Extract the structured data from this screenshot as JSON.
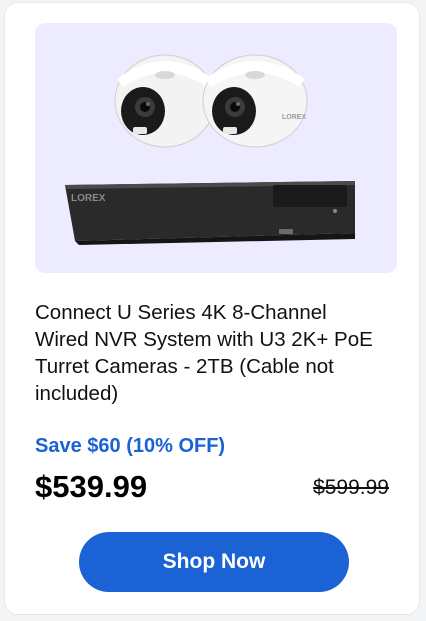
{
  "product": {
    "image_alt": "camera-system-image",
    "brand_text": "LOREX",
    "title": "Connect U Series 4K 8-Channel Wired NVR System with U3 2K+ PoE Turret Cameras - 2TB (Cable not included)",
    "save_text": "Save $60 (10% OFF)",
    "price": "$539.99",
    "original_price": "$599.99",
    "cta_label": "Shop Now"
  },
  "colors": {
    "accent": "#1b62d4",
    "image_bg": "#ecebff",
    "text": "#111111"
  }
}
